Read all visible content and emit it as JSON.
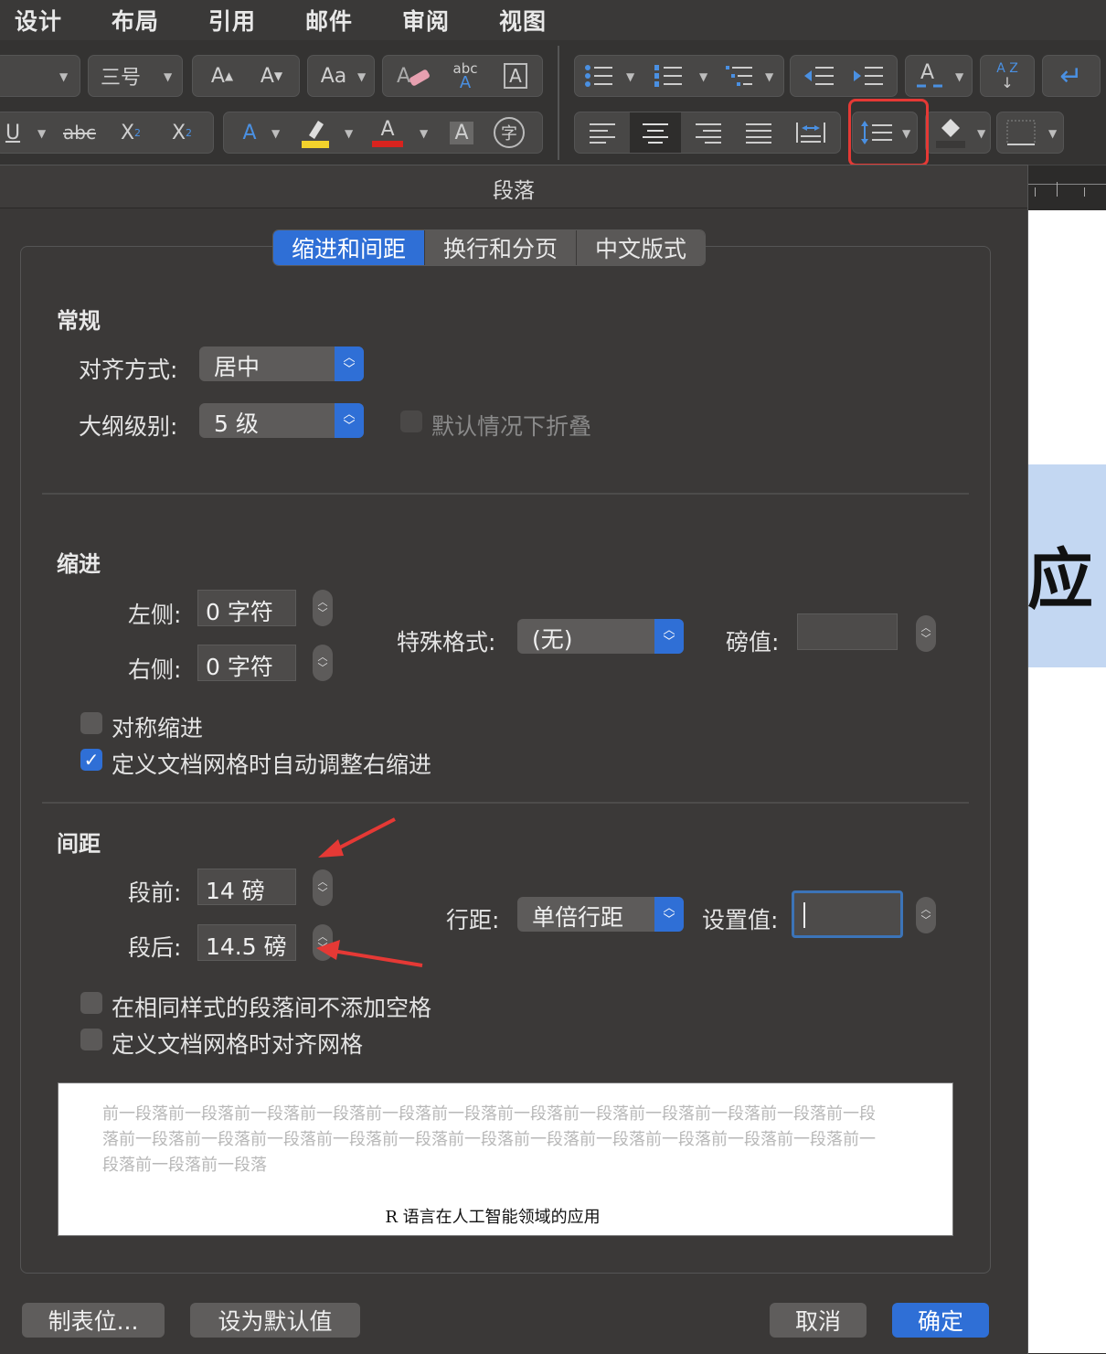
{
  "ribbon_tabs": [
    "设计",
    "布局",
    "引用",
    "邮件",
    "审阅",
    "视图"
  ],
  "ribbon": {
    "font_size": "三号",
    "grow_font": "A",
    "shrink_font": "A",
    "change_case": "Aa",
    "abc": "abc",
    "underline": "U",
    "strike": "abc",
    "sub": "X",
    "sup": "X",
    "text_effect": "A",
    "font_color": "A",
    "char_shade": "A",
    "enclose": "字",
    "az_sort": "A Z"
  },
  "dialog": {
    "title": "段落",
    "tabs": [
      "缩进和间距",
      "换行和分页",
      "中文版式"
    ],
    "general": {
      "heading": "常规",
      "alignment_label": "对齐方式:",
      "alignment_value": "居中",
      "outline_label": "大纲级别:",
      "outline_value": "5 级",
      "collapse_label": "默认情况下折叠"
    },
    "indent": {
      "heading": "缩进",
      "left_label": "左侧:",
      "left_value": "0 字符",
      "right_label": "右侧:",
      "right_value": "0 字符",
      "special_label": "特殊格式:",
      "special_value": "(无)",
      "by_label": "磅值:",
      "by_value": "",
      "mirror_label": "对称缩进",
      "auto_adjust_label": "定义文档网格时自动调整右缩进"
    },
    "spacing": {
      "heading": "间距",
      "before_label": "段前:",
      "before_value": "14 磅",
      "after_label": "段后:",
      "after_value": "14.5 磅",
      "line_label": "行距:",
      "line_value": "单倍行距",
      "at_label": "设置值:",
      "at_value": "",
      "no_space_label": "在相同样式的段落间不添加空格",
      "snap_grid_label": "定义文档网格时对齐网格"
    },
    "preview": {
      "prev_text": "前一段落前一段落前一段落前一段落前一段落前一段落前一段落前一段落前一段落前一段落前一段落前一段落前一段落前一段落前一段落前一段落前一段落前一段落前一段落前一段落前一段落前一段落前一段落前一段落前一段落前一段落",
      "sample_text": "R 语言在人工智能领域的应用"
    },
    "buttons": {
      "tabs": "制表位...",
      "default": "设为默认值",
      "cancel": "取消",
      "ok": "确定"
    }
  },
  "document": {
    "visible_char": "应"
  },
  "colors": {
    "accent": "#2f6fd6",
    "annotation": "#e53935",
    "doc_highlight": "#c3d7f2"
  }
}
